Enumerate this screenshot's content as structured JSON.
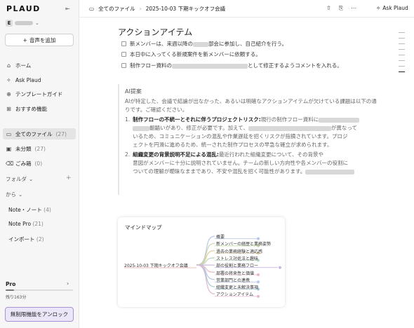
{
  "app": {
    "logo": "PLAUD",
    "workspace_initial": "E"
  },
  "sidebar": {
    "add_audio": "音声を追加",
    "nav": [
      {
        "icon": "home-icon",
        "label": "ホーム"
      },
      {
        "icon": "sparkle-icon",
        "label": "Ask Plaud"
      },
      {
        "icon": "template-icon",
        "label": "テンプレートガイド"
      },
      {
        "icon": "grid-icon",
        "label": "おすすめ機能"
      }
    ],
    "files": [
      {
        "icon": "folder-icon",
        "label": "全てのファイル",
        "count": "(27)"
      },
      {
        "icon": "inbox-icon",
        "label": "未分類",
        "count": "(27)"
      },
      {
        "icon": "trash-icon",
        "label": "ごみ箱",
        "count": "(0)"
      }
    ],
    "folder_section": "フォルダ",
    "from_section": "から",
    "sources": [
      {
        "label": "Note・ノート",
        "count": "(4)"
      },
      {
        "label": "Note Pro",
        "count": "(21)"
      },
      {
        "label": "インポート",
        "count": "(2)"
      }
    ],
    "plan": {
      "name": "Pro",
      "remaining": "残り163分",
      "usage_fraction": 0.12
    },
    "unlock": "無制限機能をアンロック"
  },
  "topbar": {
    "breadcrumb": [
      "全てのファイル",
      "2025-10-03 下期キックオフ会議"
    ],
    "ask": "Ask Plaud"
  },
  "content": {
    "action_title": "アクションアイテム",
    "todos": [
      {
        "a": "新メンバーは、来週以降の",
        "b": "部会に参加し、自己紹介を行う。"
      },
      {
        "a": "本日中に入ってくる新規案件を新メンバーに依頼する。",
        "b": ""
      },
      {
        "a": "制作フロー資料の",
        "b": "として修正するようコメントを入れる。"
      }
    ],
    "ai": {
      "title": "AI提案",
      "intro": "AIが特定した、会議で結論が出なかった、あるいは明確なアクションアイテムが欠けている課題は以下の通りです。ご確認ください。",
      "items": [
        {
          "num": "1.",
          "bold": "制作フローの不統一とそれに伴うプロジェクトリスク:",
          "l1": "現行の制作フロー資料に",
          "l2": "齟齬いがあり、修正が必要です。加えて、",
          "l2b": "が異なって",
          "l3": "いるため、コミュニケーションの混乱や作業遅延を招くリスクが指摘されています。プロジ",
          "l4": "ェクトを円滑に進めるため、統一された制作プロセスの早急な確立が求められます。"
        },
        {
          "num": "2.",
          "bold": "組織変更の背景説明不足による混乱:",
          "l1": "最近行われた組織変更について、その背景や",
          "l2": "意図がメンバーに十分に説明されていません。チームの新しい方向性や各メンバーの役割に",
          "l2b": "",
          "l3": "ついての理解が曖昧なままであり、不安や混乱を招く可能性があります。",
          "l4": ""
        }
      ]
    },
    "mindmap": {
      "title": "マインドマップ",
      "root": "2025-10-03 下期キックオフ会議",
      "branches": [
        {
          "label": "概要",
          "color": "#b7c9e8"
        },
        {
          "label": "新メンバーの経歴と業務姿勢",
          "color": "#c6d9a6"
        },
        {
          "label": "過去の業務経験と適応感",
          "color": "#e3cc9a"
        },
        {
          "label": "ストレス対処法と趣味",
          "color": "#b5d8c0"
        },
        {
          "label": "部の役割と業務フロー",
          "color": "#c9b7e3"
        },
        {
          "label": "部署の将来性と価値",
          "color": "#e8b7c9"
        },
        {
          "label": "営業部門との連携",
          "color": "#b7c9e8"
        },
        {
          "label": "組織変更と未解決事項",
          "color": "#a6c9d9"
        },
        {
          "label": "アクションアイテム",
          "color": "#e3b7d0"
        }
      ]
    }
  }
}
